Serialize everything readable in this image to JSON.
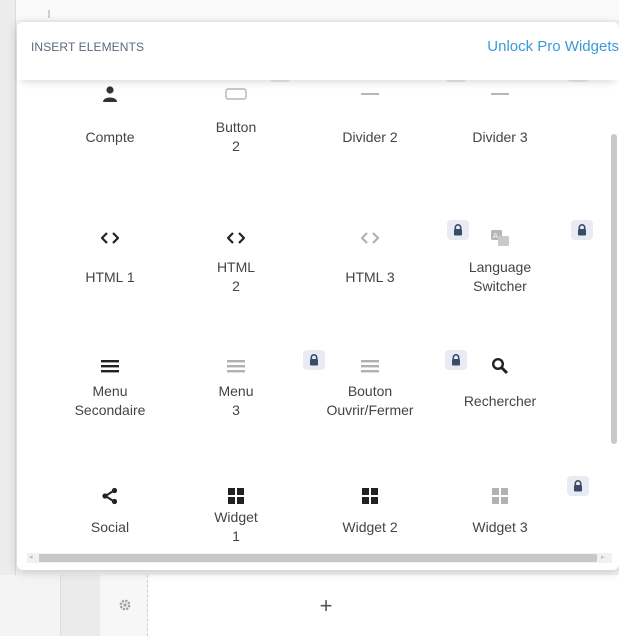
{
  "panel": {
    "title": "INSERT ELEMENTS",
    "unlock_label": "Unlock Pro Widgets"
  },
  "colors": {
    "accent": "#3a9ad9",
    "title": "#5b6b7c",
    "lock_bg": "#e8ecf2",
    "lock_fg": "#3b4a66"
  },
  "elements": [
    {
      "label": "Compte",
      "icon": "user-icon",
      "locked": false
    },
    {
      "label": "Button\n2",
      "icon": "button-icon",
      "locked": true
    },
    {
      "label": "Divider 2",
      "icon": "divider-icon",
      "locked": true
    },
    {
      "label": "Divider 3",
      "icon": "divider-icon",
      "locked": true
    },
    {
      "label": "HTML 1",
      "icon": "code-icon",
      "locked": false
    },
    {
      "label": "HTML\n2",
      "icon": "code-icon",
      "locked": false
    },
    {
      "label": "HTML 3",
      "icon": "code-icon",
      "locked": true
    },
    {
      "label": "Language\nSwitcher",
      "icon": "language-icon",
      "locked": true
    },
    {
      "label": "Menu\nSecondaire",
      "icon": "menu-icon",
      "locked": false
    },
    {
      "label": "Menu\n3",
      "icon": "menu-icon",
      "locked": true
    },
    {
      "label": "Bouton\nOuvrir/Fermer",
      "icon": "menu-icon",
      "locked": true
    },
    {
      "label": "Rechercher",
      "icon": "search-icon",
      "locked": false
    },
    {
      "label": "Social",
      "icon": "share-icon",
      "locked": false
    },
    {
      "label": "Widget\n1",
      "icon": "widget-icon",
      "locked": false
    },
    {
      "label": "Widget 2",
      "icon": "widget-icon",
      "locked": false
    },
    {
      "label": "Widget 3",
      "icon": "widget-icon",
      "locked": true
    }
  ],
  "builder": {
    "settings_icon": "gear-icon",
    "add_label": "+"
  }
}
